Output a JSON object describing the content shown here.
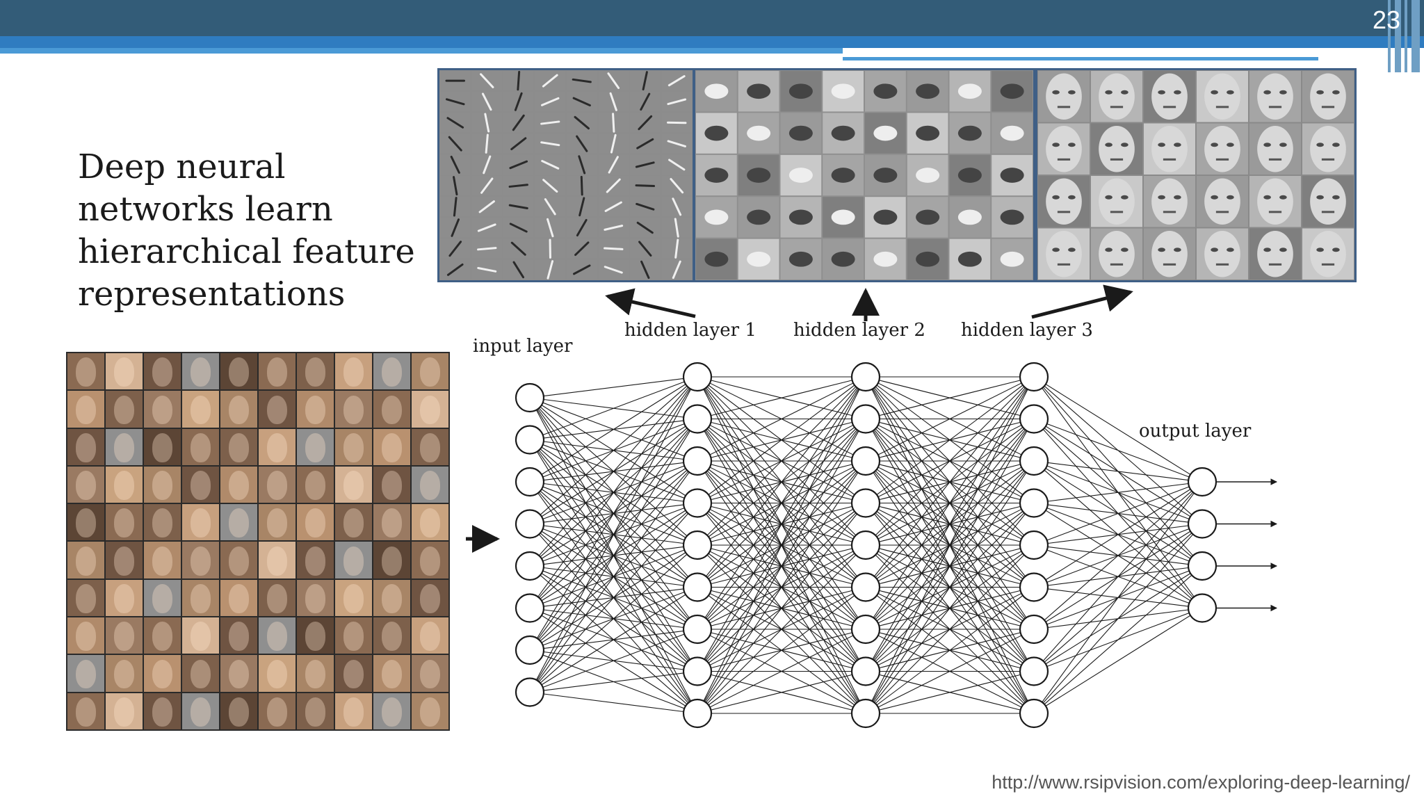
{
  "slide": {
    "number": "23",
    "title": "Deep neural\nnetworks learn\nhierarchical feature\nrepresentations",
    "source_url": "http://www.rsipvision.com/exploring-deep-learning/"
  },
  "diagram": {
    "labels": {
      "input": "input layer",
      "hidden1": "hidden layer 1",
      "hidden2": "hidden layer 2",
      "hidden3": "hidden layer 3",
      "output": "output layer"
    },
    "layer_sizes": [
      8,
      9,
      9,
      9,
      4
    ],
    "feature_panels": [
      "edge-features",
      "face-part-features",
      "face-features"
    ],
    "face_grid": {
      "rows": 10,
      "cols": 10
    }
  },
  "colors": {
    "header": "#335c78",
    "accent": "#2f7cc0",
    "panel_border": "#3f5f86",
    "diagram_ink": "#1a1a1a"
  }
}
